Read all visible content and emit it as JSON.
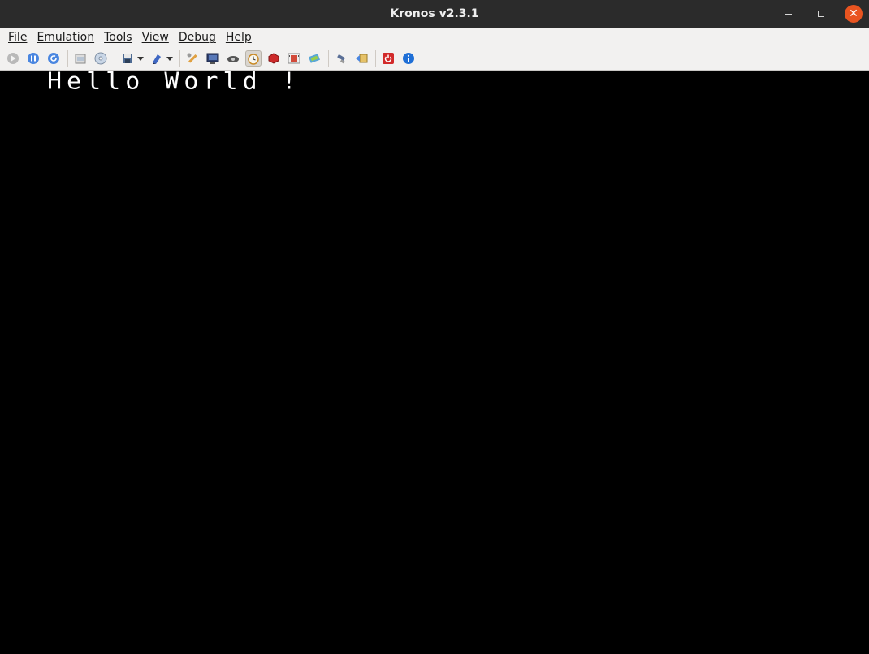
{
  "window": {
    "title": "Kronos v2.3.1"
  },
  "menu": {
    "items": [
      {
        "label": "File"
      },
      {
        "label": "Emulation"
      },
      {
        "label": "Tools"
      },
      {
        "label": "View"
      },
      {
        "label": "Debug"
      },
      {
        "label": "Help"
      }
    ]
  },
  "toolbar": {
    "icons": [
      "play-icon",
      "pause-icon",
      "reset-icon",
      "open-iso-icon",
      "open-cd-icon",
      "save-state-icon",
      "load-state-icon",
      "settings-icon",
      "screenshot-icon",
      "cheats-icon",
      "frameskip-icon",
      "record-icon",
      "tape-icon",
      "memory-icon",
      "backup-icon",
      "transfer-icon",
      "quit-icon",
      "about-icon"
    ]
  },
  "screen": {
    "text": "Hello World !"
  },
  "colors": {
    "titlebar": "#2b2b2b",
    "close": "#e95420",
    "screen": "#000000",
    "text": "#ffffff"
  }
}
